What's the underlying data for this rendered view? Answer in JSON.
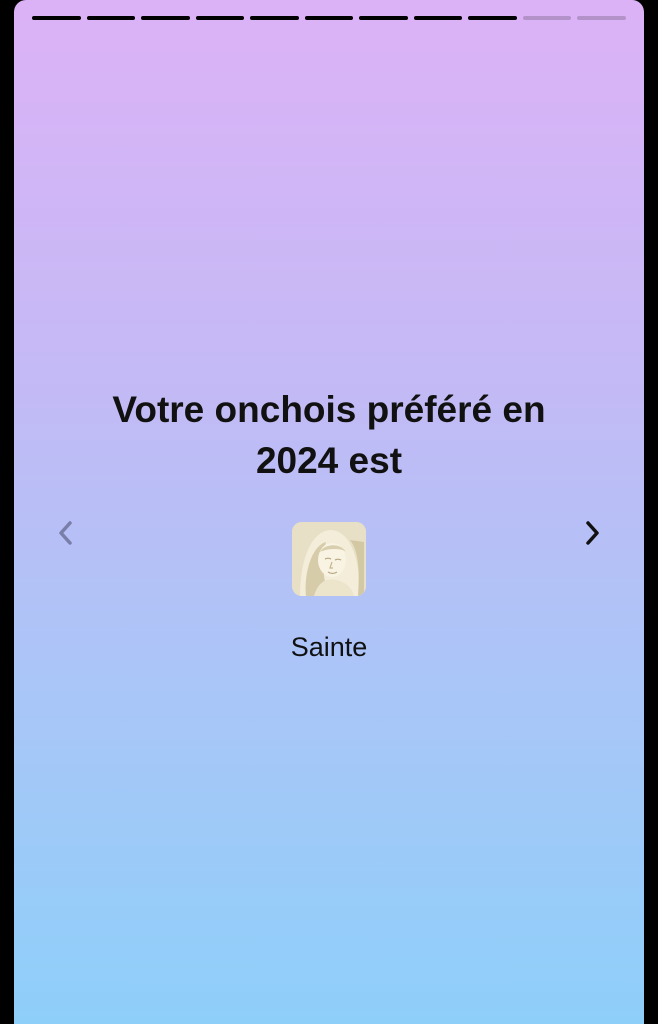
{
  "story": {
    "title": "Votre onchois préféré en 2024 est",
    "item_label": "Sainte",
    "item_image_icon": "statue-image",
    "progress": {
      "total_segments": 11,
      "completed_segments": 9
    },
    "nav": {
      "prev_icon": "chevron-left-icon",
      "next_icon": "chevron-right-icon"
    }
  },
  "colors": {
    "gradient_top": "#dcb2f6",
    "gradient_bottom": "#8ecff9",
    "progress_done": "#000000",
    "progress_pending": "rgba(0,0,0,0.18)",
    "text": "#111111"
  }
}
